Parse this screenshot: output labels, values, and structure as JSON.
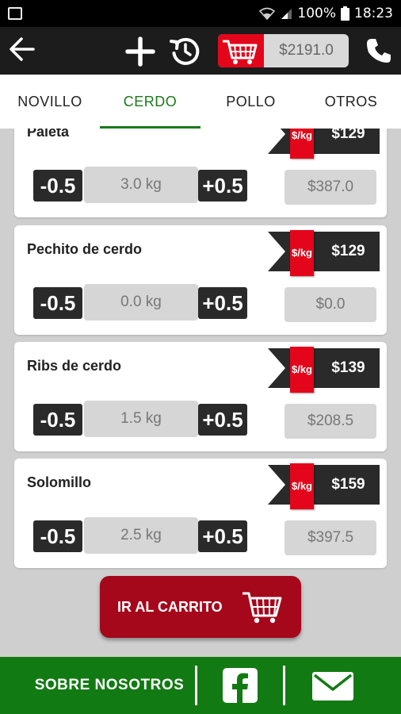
{
  "status_bar": {
    "battery": "100%",
    "time": "18:23"
  },
  "app_bar": {
    "cart_total": "$2191.0"
  },
  "tabs": [
    {
      "label": "NOVILLO",
      "active": false
    },
    {
      "label": "CERDO",
      "active": true
    },
    {
      "label": "POLLO",
      "active": false
    },
    {
      "label": "OTROS",
      "active": false
    }
  ],
  "products": [
    {
      "name": "Paleta",
      "unit": "$/kg",
      "price": "$129",
      "minus_label": "-0.5",
      "plus_label": "+0.5",
      "quantity": "3.0 kg",
      "subtotal": "$387.0"
    },
    {
      "name": "Pechito de cerdo",
      "unit": "$/kg",
      "price": "$129",
      "minus_label": "-0.5",
      "plus_label": "+0.5",
      "quantity": "0.0 kg",
      "subtotal": "$0.0"
    },
    {
      "name": "Ribs de cerdo",
      "unit": "$/kg",
      "price": "$139",
      "minus_label": "-0.5",
      "plus_label": "+0.5",
      "quantity": "1.5 kg",
      "subtotal": "$208.5"
    },
    {
      "name": "Solomillo",
      "unit": "$/kg",
      "price": "$159",
      "minus_label": "-0.5",
      "plus_label": "+0.5",
      "quantity": "2.5 kg",
      "subtotal": "$397.5"
    }
  ],
  "go_cart_button": {
    "label": "IR AL CARRITO"
  },
  "footer": {
    "about_label": "SOBRE NOSOTROS"
  },
  "icons": {
    "back": "arrow-left-icon",
    "add": "plus-icon",
    "history": "history-icon",
    "cart": "shopping-cart-icon",
    "phone": "phone-icon",
    "facebook": "facebook-icon",
    "mail": "mail-icon"
  },
  "colors": {
    "accent_red": "#e3061b",
    "button_red": "#a5071b",
    "brand_green": "#127a12",
    "active_tab": "#1a7a1a",
    "dark": "#1c1c1c"
  }
}
